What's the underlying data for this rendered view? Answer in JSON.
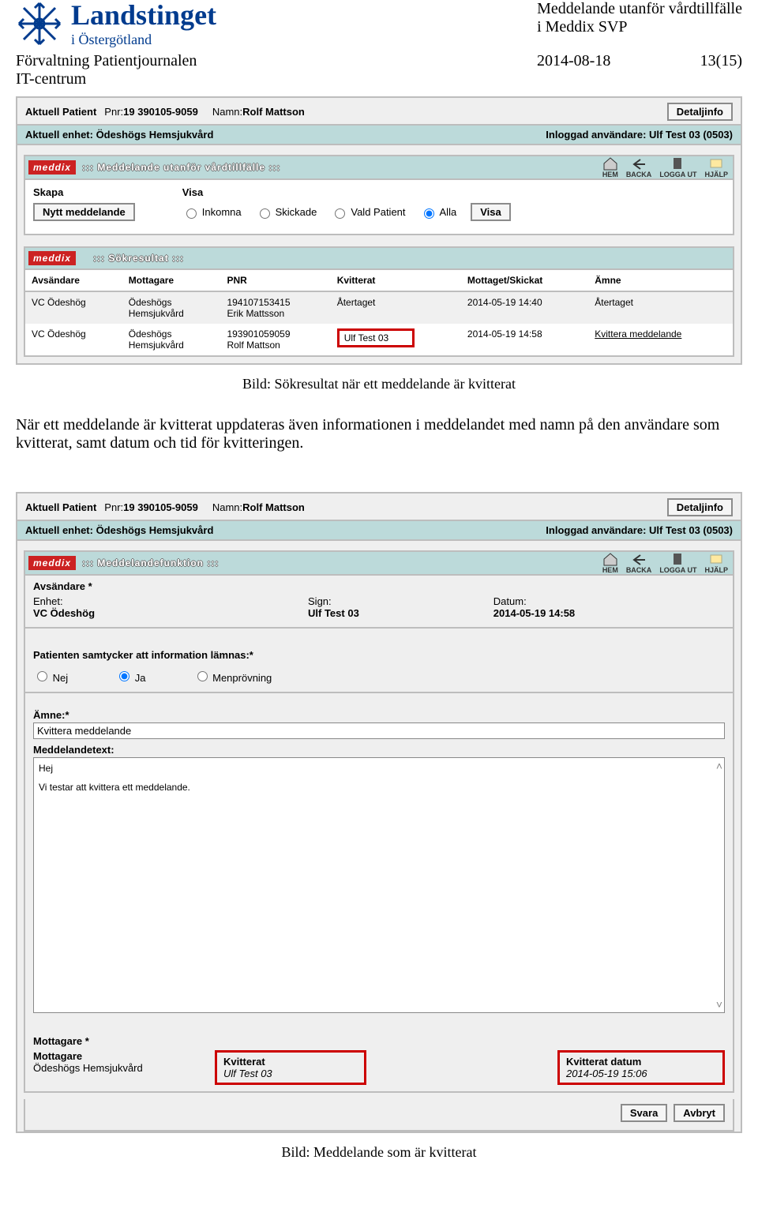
{
  "doc": {
    "brand": "Landstinget",
    "brand_sub": "i Östergötland",
    "right_title1": "Meddelande utanför vårdtillfälle",
    "right_title2": "i Meddix SVP",
    "left1": "Förvaltning Patientjournalen",
    "left2": "IT-centrum",
    "date": "2014-08-18",
    "page": "13(15)"
  },
  "patient": {
    "hdr": "Aktuell Patient",
    "pnr_lbl": "Pnr:",
    "pnr": "19 390105-9059",
    "namn_lbl": "Namn:",
    "namn": "Rolf Mattson",
    "detail_btn": "Detaljinfo",
    "unit_lbl": "Aktuell enhet: Ödeshögs Hemsjukvård",
    "user_lbl": "Inloggad användare: Ulf Test 03 (0503)"
  },
  "bar1": {
    "logo": "meddix",
    "title": "::: Meddelande utanför vårdtillfälle :::"
  },
  "nav": {
    "hem": "HEM",
    "backa": "BACKA",
    "logga": "LOGGA UT",
    "hjalp": "HJÄLP"
  },
  "filters": {
    "skapa": "Skapa",
    "nytt_btn": "Nytt meddelande",
    "visa_lbl": "Visa",
    "r1": "Inkomna",
    "r2": "Skickade",
    "r3": "Vald Patient",
    "r4": "Alla",
    "visa_btn": "Visa"
  },
  "results": {
    "logo": "meddix",
    "title": "::: Sökresultat :::",
    "cols": [
      "Avsändare",
      "Mottagare",
      "PNR",
      "Kvitterat",
      "Mottaget/Skickat",
      "Ämne"
    ],
    "rows": [
      {
        "avs": "VC Ödeshög",
        "mott1": "Ödeshögs",
        "mott2": "Hemsjukvård",
        "pnr1": "194107153415",
        "pnr2": "Erik Mattsson",
        "kv": "Återtaget",
        "dt": "2014-05-19 14:40",
        "amne": "Återtaget",
        "hl": false,
        "link": false
      },
      {
        "avs": "VC Ödeshög",
        "mott1": "Ödeshögs",
        "mott2": "Hemsjukvård",
        "pnr1": "193901059059",
        "pnr2": "Rolf Mattson",
        "kv": "Ulf Test 03",
        "dt": "2014-05-19 14:58",
        "amne": "Kvittera meddelande",
        "hl": true,
        "link": true
      }
    ]
  },
  "caption1": "Bild: Sökresultat när ett meddelande är kvitterat",
  "body_para": "När ett meddelande är kvitterat uppdateras även informationen i meddelandet med namn på den användare som kvitterat, samt datum och tid för kvitteringen.",
  "bar2": {
    "logo": "meddix",
    "title": "::: Meddelandefunktion :::"
  },
  "sender": {
    "legend": "Avsändare *",
    "enhet_lbl": "Enhet:",
    "enhet": "VC Ödeshög",
    "sign_lbl": "Sign:",
    "sign": "Ulf Test 03",
    "datum_lbl": "Datum:",
    "datum": "2014-05-19 14:58"
  },
  "consent": {
    "legend": "Patienten samtycker att information lämnas:*",
    "nej": "Nej",
    "ja": "Ja",
    "men": "Menprövning"
  },
  "subject": {
    "lbl": "Ämne:*",
    "val": "Kvittera meddelande"
  },
  "msg": {
    "lbl": "Meddelandetext:",
    "l1": "Hej",
    "l2": "Vi testar att kvittera ett meddelande."
  },
  "recip": {
    "legend": "Mottagare *",
    "h1": "Mottagare",
    "v1": "Ödeshögs Hemsjukvård",
    "h2": "Kvitterat",
    "v2": "Ulf Test 03",
    "h3": "Kvitterat datum",
    "v3": "2014-05-19 15:06"
  },
  "actions": {
    "svara": "Svara",
    "avbryt": "Avbryt"
  },
  "caption2": "Bild: Meddelande som är kvitterat"
}
